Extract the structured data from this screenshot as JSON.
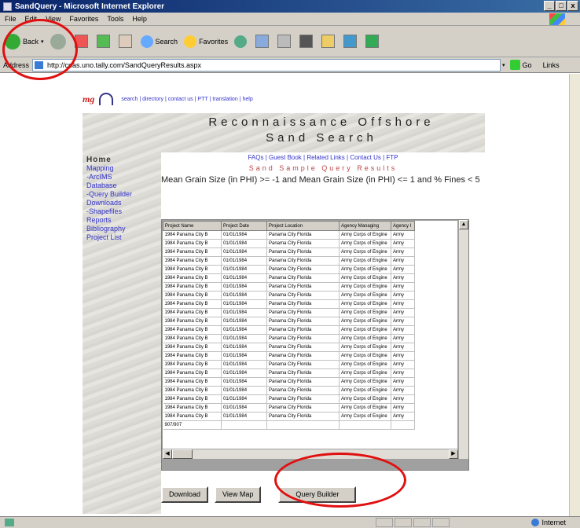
{
  "window": {
    "title": "SandQuery - Microsoft Internet Explorer",
    "min": "_",
    "max": "□",
    "close": "x"
  },
  "menu": [
    "File",
    "Edit",
    "View",
    "Favorites",
    "Tools",
    "Help"
  ],
  "toolbar": {
    "back": "Back",
    "search": "Search",
    "favorites": "Favorites"
  },
  "address": {
    "label": "Address",
    "url": "http://coas.uno.tally.com/SandQueryResults.aspx",
    "go": "Go",
    "links": "Links"
  },
  "header": {
    "logo": "mg",
    "links": [
      "search",
      "directory",
      "contact us",
      "PTT",
      "translation",
      "help"
    ]
  },
  "banner": {
    "line1": "Reconnaissance Offshore",
    "line2": "Sand Search"
  },
  "sidebar": {
    "home": "Home",
    "items": [
      "Mapping",
      "-ArcIMS",
      "Database",
      "-Query Builder",
      "Downloads",
      "-Shapefiles",
      "Reports",
      "Bibliography",
      "Project List"
    ]
  },
  "panel": {
    "quick_links": "FAQs | Guest Book | Related Links | Contact Us | FTP",
    "subtitle": "Sand Sample Query Results",
    "query": "Mean Grain Size (in PHI) >= -1 and Mean Grain Size (in PHI) <= 1 and % Fines < 5"
  },
  "grid": {
    "columns": [
      "Project Name",
      "Project Date",
      "Project Location",
      "Agency Managing",
      "Agency I"
    ],
    "rows": [
      [
        "1984 Panama City B",
        "01/01/1984",
        "Panama City Florida",
        "Army Corps of Engine",
        "Army"
      ],
      [
        "1984 Panama City B",
        "01/01/1984",
        "Panama City Florida",
        "Army Corps of Engine",
        "Army"
      ],
      [
        "1984 Panama City B",
        "01/01/1984",
        "Panama City Florida",
        "Army Corps of Engine",
        "Army"
      ],
      [
        "1984 Panama City B",
        "01/01/1984",
        "Panama City Florida",
        "Army Corps of Engine",
        "Army"
      ],
      [
        "1984 Panama City B",
        "01/01/1984",
        "Panama City Florida",
        "Army Corps of Engine",
        "Army"
      ],
      [
        "1984 Panama City B",
        "01/01/1984",
        "Panama City Florida",
        "Army Corps of Engine",
        "Army"
      ],
      [
        "1984 Panama City B",
        "01/01/1984",
        "Panama City Florida",
        "Army Corps of Engine",
        "Army"
      ],
      [
        "1984 Panama City B",
        "01/01/1984",
        "Panama City Florida",
        "Army Corps of Engine",
        "Army"
      ],
      [
        "1984 Panama City B",
        "01/01/1984",
        "Panama City Florida",
        "Army Corps of Engine",
        "Army"
      ],
      [
        "1984 Panama City B",
        "01/01/1984",
        "Panama City Florida",
        "Army Corps of Engine",
        "Army"
      ],
      [
        "1984 Panama City B",
        "01/01/1984",
        "Panama City Florida",
        "Army Corps of Engine",
        "Army"
      ],
      [
        "1984 Panama City B",
        "01/01/1984",
        "Panama City Florida",
        "Army Corps of Engine",
        "Army"
      ],
      [
        "1984 Panama City B",
        "01/01/1984",
        "Panama City Florida",
        "Army Corps of Engine",
        "Army"
      ],
      [
        "1984 Panama City B",
        "01/01/1984",
        "Panama City Florida",
        "Army Corps of Engine",
        "Army"
      ],
      [
        "1984 Panama City B",
        "01/01/1984",
        "Panama City Florida",
        "Army Corps of Engine",
        "Army"
      ],
      [
        "1984 Panama City B",
        "01/01/1984",
        "Panama City Florida",
        "Army Corps of Engine",
        "Army"
      ],
      [
        "1984 Panama City B",
        "01/01/1984",
        "Panama City Florida",
        "Army Corps of Engine",
        "Army"
      ],
      [
        "1984 Panama City B",
        "01/01/1984",
        "Panama City Florida",
        "Army Corps of Engine",
        "Army"
      ],
      [
        "1984 Panama City B",
        "01/01/1984",
        "Panama City Florida",
        "Army Corps of Engine",
        "Army"
      ],
      [
        "1984 Panama City B",
        "01/01/1984",
        "Panama City Florida",
        "Army Corps of Engine",
        "Army"
      ],
      [
        "1984 Panama City B",
        "01/01/1984",
        "Panama City Florida",
        "Army Corps of Engine",
        "Army"
      ],
      [
        "1984 Panama City B",
        "01/01/1984",
        "Panama City Florida",
        "Army Corps of Engine",
        "Army"
      ]
    ],
    "footer": "907/907"
  },
  "buttons": {
    "download": "Download",
    "view_map": "View Map",
    "query_builder": "Query Builder"
  },
  "status": {
    "zone": "Internet"
  },
  "colors": {
    "annotation": "#e01010",
    "title_bar": "#0a246a",
    "link": "#3333cc"
  }
}
